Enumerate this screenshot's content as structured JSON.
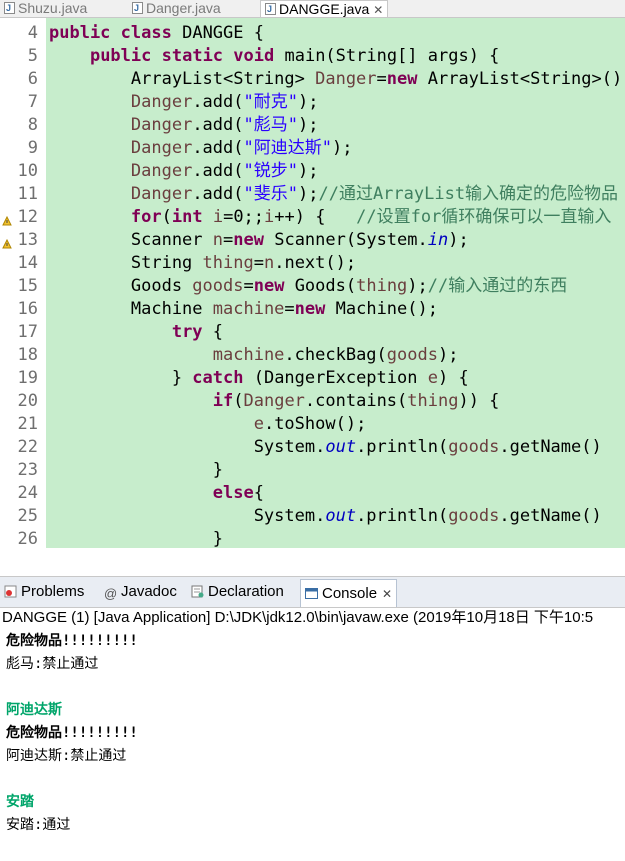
{
  "editor_tabs": [
    {
      "label": "Shuzu.java",
      "active": false
    },
    {
      "label": "Danger.java",
      "active": false
    },
    {
      "label": "DANGGE.java",
      "active": true
    }
  ],
  "code": {
    "line_numbers": [
      "4",
      "5",
      "6",
      "7",
      "8",
      "9",
      "10",
      "11",
      "12",
      "13",
      "14",
      "15",
      "16",
      "17",
      "18",
      "19",
      "20",
      "21",
      "22",
      "23",
      "24",
      "25",
      "26"
    ],
    "lines": [
      [
        {
          "t": "public",
          "c": "kw"
        },
        {
          "t": " "
        },
        {
          "t": "class",
          "c": "kw"
        },
        {
          "t": " DANGGE {"
        }
      ],
      [
        {
          "t": "    "
        },
        {
          "t": "public",
          "c": "kw"
        },
        {
          "t": " "
        },
        {
          "t": "static",
          "c": "kw"
        },
        {
          "t": " "
        },
        {
          "t": "void",
          "c": "kw"
        },
        {
          "t": " main(String[] args) {"
        }
      ],
      [
        {
          "t": "        ArrayList<String> "
        },
        {
          "t": "Danger",
          "c": "var"
        },
        {
          "t": "="
        },
        {
          "t": "new",
          "c": "kw"
        },
        {
          "t": " ArrayList<String>();"
        }
      ],
      [
        {
          "t": "        "
        },
        {
          "t": "Danger",
          "c": "var"
        },
        {
          "t": ".add("
        },
        {
          "t": "\"耐克\"",
          "c": "str"
        },
        {
          "t": ");"
        }
      ],
      [
        {
          "t": "        "
        },
        {
          "t": "Danger",
          "c": "var"
        },
        {
          "t": ".add("
        },
        {
          "t": "\"彪马\"",
          "c": "str"
        },
        {
          "t": ");"
        }
      ],
      [
        {
          "t": "        "
        },
        {
          "t": "Danger",
          "c": "var"
        },
        {
          "t": ".add("
        },
        {
          "t": "\"阿迪达斯\"",
          "c": "str"
        },
        {
          "t": ");"
        }
      ],
      [
        {
          "t": "        "
        },
        {
          "t": "Danger",
          "c": "var"
        },
        {
          "t": ".add("
        },
        {
          "t": "\"锐步\"",
          "c": "str"
        },
        {
          "t": ");"
        }
      ],
      [
        {
          "t": "        "
        },
        {
          "t": "Danger",
          "c": "var"
        },
        {
          "t": ".add("
        },
        {
          "t": "\"斐乐\"",
          "c": "str"
        },
        {
          "t": ");"
        },
        {
          "t": "//通过ArrayList输入确定的危险物品",
          "c": "cmt"
        }
      ],
      [
        {
          "t": "        "
        },
        {
          "t": "for",
          "c": "kw"
        },
        {
          "t": "("
        },
        {
          "t": "int",
          "c": "kw"
        },
        {
          "t": " "
        },
        {
          "t": "i",
          "c": "var"
        },
        {
          "t": "=0;;"
        },
        {
          "t": "i",
          "c": "var"
        },
        {
          "t": "++) {   "
        },
        {
          "t": "//设置for循环确保可以一直输入",
          "c": "cmt"
        }
      ],
      [
        {
          "t": "        Scanner "
        },
        {
          "t": "n",
          "c": "var"
        },
        {
          "t": "="
        },
        {
          "t": "new",
          "c": "kw"
        },
        {
          "t": " Scanner(System."
        },
        {
          "t": "in",
          "c": "fld"
        },
        {
          "t": ");"
        }
      ],
      [
        {
          "t": "        String "
        },
        {
          "t": "thing",
          "c": "var"
        },
        {
          "t": "="
        },
        {
          "t": "n",
          "c": "var"
        },
        {
          "t": ".next();"
        }
      ],
      [
        {
          "t": "        Goods "
        },
        {
          "t": "goods",
          "c": "var"
        },
        {
          "t": "="
        },
        {
          "t": "new",
          "c": "kw"
        },
        {
          "t": " Goods("
        },
        {
          "t": "thing",
          "c": "var"
        },
        {
          "t": ");"
        },
        {
          "t": "//输入通过的东西",
          "c": "cmt"
        }
      ],
      [
        {
          "t": "        Machine "
        },
        {
          "t": "machine",
          "c": "var"
        },
        {
          "t": "="
        },
        {
          "t": "new",
          "c": "kw"
        },
        {
          "t": " Machine();"
        }
      ],
      [
        {
          "t": "            "
        },
        {
          "t": "try",
          "c": "kw"
        },
        {
          "t": " {"
        }
      ],
      [
        {
          "t": "                "
        },
        {
          "t": "machine",
          "c": "var"
        },
        {
          "t": ".checkBag("
        },
        {
          "t": "goods",
          "c": "var"
        },
        {
          "t": ");"
        }
      ],
      [
        {
          "t": "            } "
        },
        {
          "t": "catch",
          "c": "kw"
        },
        {
          "t": " (DangerException "
        },
        {
          "t": "e",
          "c": "var"
        },
        {
          "t": ") {"
        }
      ],
      [
        {
          "t": "                "
        },
        {
          "t": "if",
          "c": "kw"
        },
        {
          "t": "("
        },
        {
          "t": "Danger",
          "c": "var"
        },
        {
          "t": ".contains("
        },
        {
          "t": "thing",
          "c": "var"
        },
        {
          "t": ")) {"
        }
      ],
      [
        {
          "t": "                    "
        },
        {
          "t": "e",
          "c": "var"
        },
        {
          "t": ".toShow();"
        }
      ],
      [
        {
          "t": "                    System."
        },
        {
          "t": "out",
          "c": "fld"
        },
        {
          "t": ".println("
        },
        {
          "t": "goods",
          "c": "var"
        },
        {
          "t": ".getName()"
        }
      ],
      [
        {
          "t": "                }"
        }
      ],
      [
        {
          "t": "                "
        },
        {
          "t": "else",
          "c": "kw"
        },
        {
          "t": "{"
        }
      ],
      [
        {
          "t": "                    System."
        },
        {
          "t": "out",
          "c": "fld"
        },
        {
          "t": ".println("
        },
        {
          "t": "goods",
          "c": "var"
        },
        {
          "t": ".getName()"
        }
      ],
      [
        {
          "t": "                }"
        }
      ]
    ],
    "warning_marker_lines": [
      8,
      9
    ]
  },
  "view_tabs": [
    {
      "label": "Problems",
      "icon": "problems-icon",
      "active": false
    },
    {
      "label": "Javadoc",
      "icon": "at-sign-icon",
      "active": false
    },
    {
      "label": "Declaration",
      "icon": "declaration-icon",
      "active": false
    },
    {
      "label": "Console",
      "icon": "console-icon",
      "active": true
    }
  ],
  "console": {
    "header": "DANGGE (1) [Java Application] D:\\JDK\\jdk12.0\\bin\\javaw.exe (2019年10月18日 下午10:5",
    "lines": [
      {
        "text": "危险物品!!!!!!!!!",
        "kind": "bold"
      },
      {
        "text": "彪马:禁止通过",
        "kind": "out"
      },
      {
        "text": "",
        "kind": "out"
      },
      {
        "text": "阿迪达斯",
        "kind": "input"
      },
      {
        "text": "危险物品!!!!!!!!!",
        "kind": "bold"
      },
      {
        "text": "阿迪达斯:禁止通过",
        "kind": "out"
      },
      {
        "text": "",
        "kind": "out"
      },
      {
        "text": "安踏",
        "kind": "input"
      },
      {
        "text": "安踏:通过",
        "kind": "out"
      }
    ]
  },
  "colors": {
    "editor_background": "#c7edcc",
    "keyword": "#7f0055",
    "string": "#2a00ff",
    "comment": "#3f7f5f",
    "console_input": "#00a56a"
  }
}
